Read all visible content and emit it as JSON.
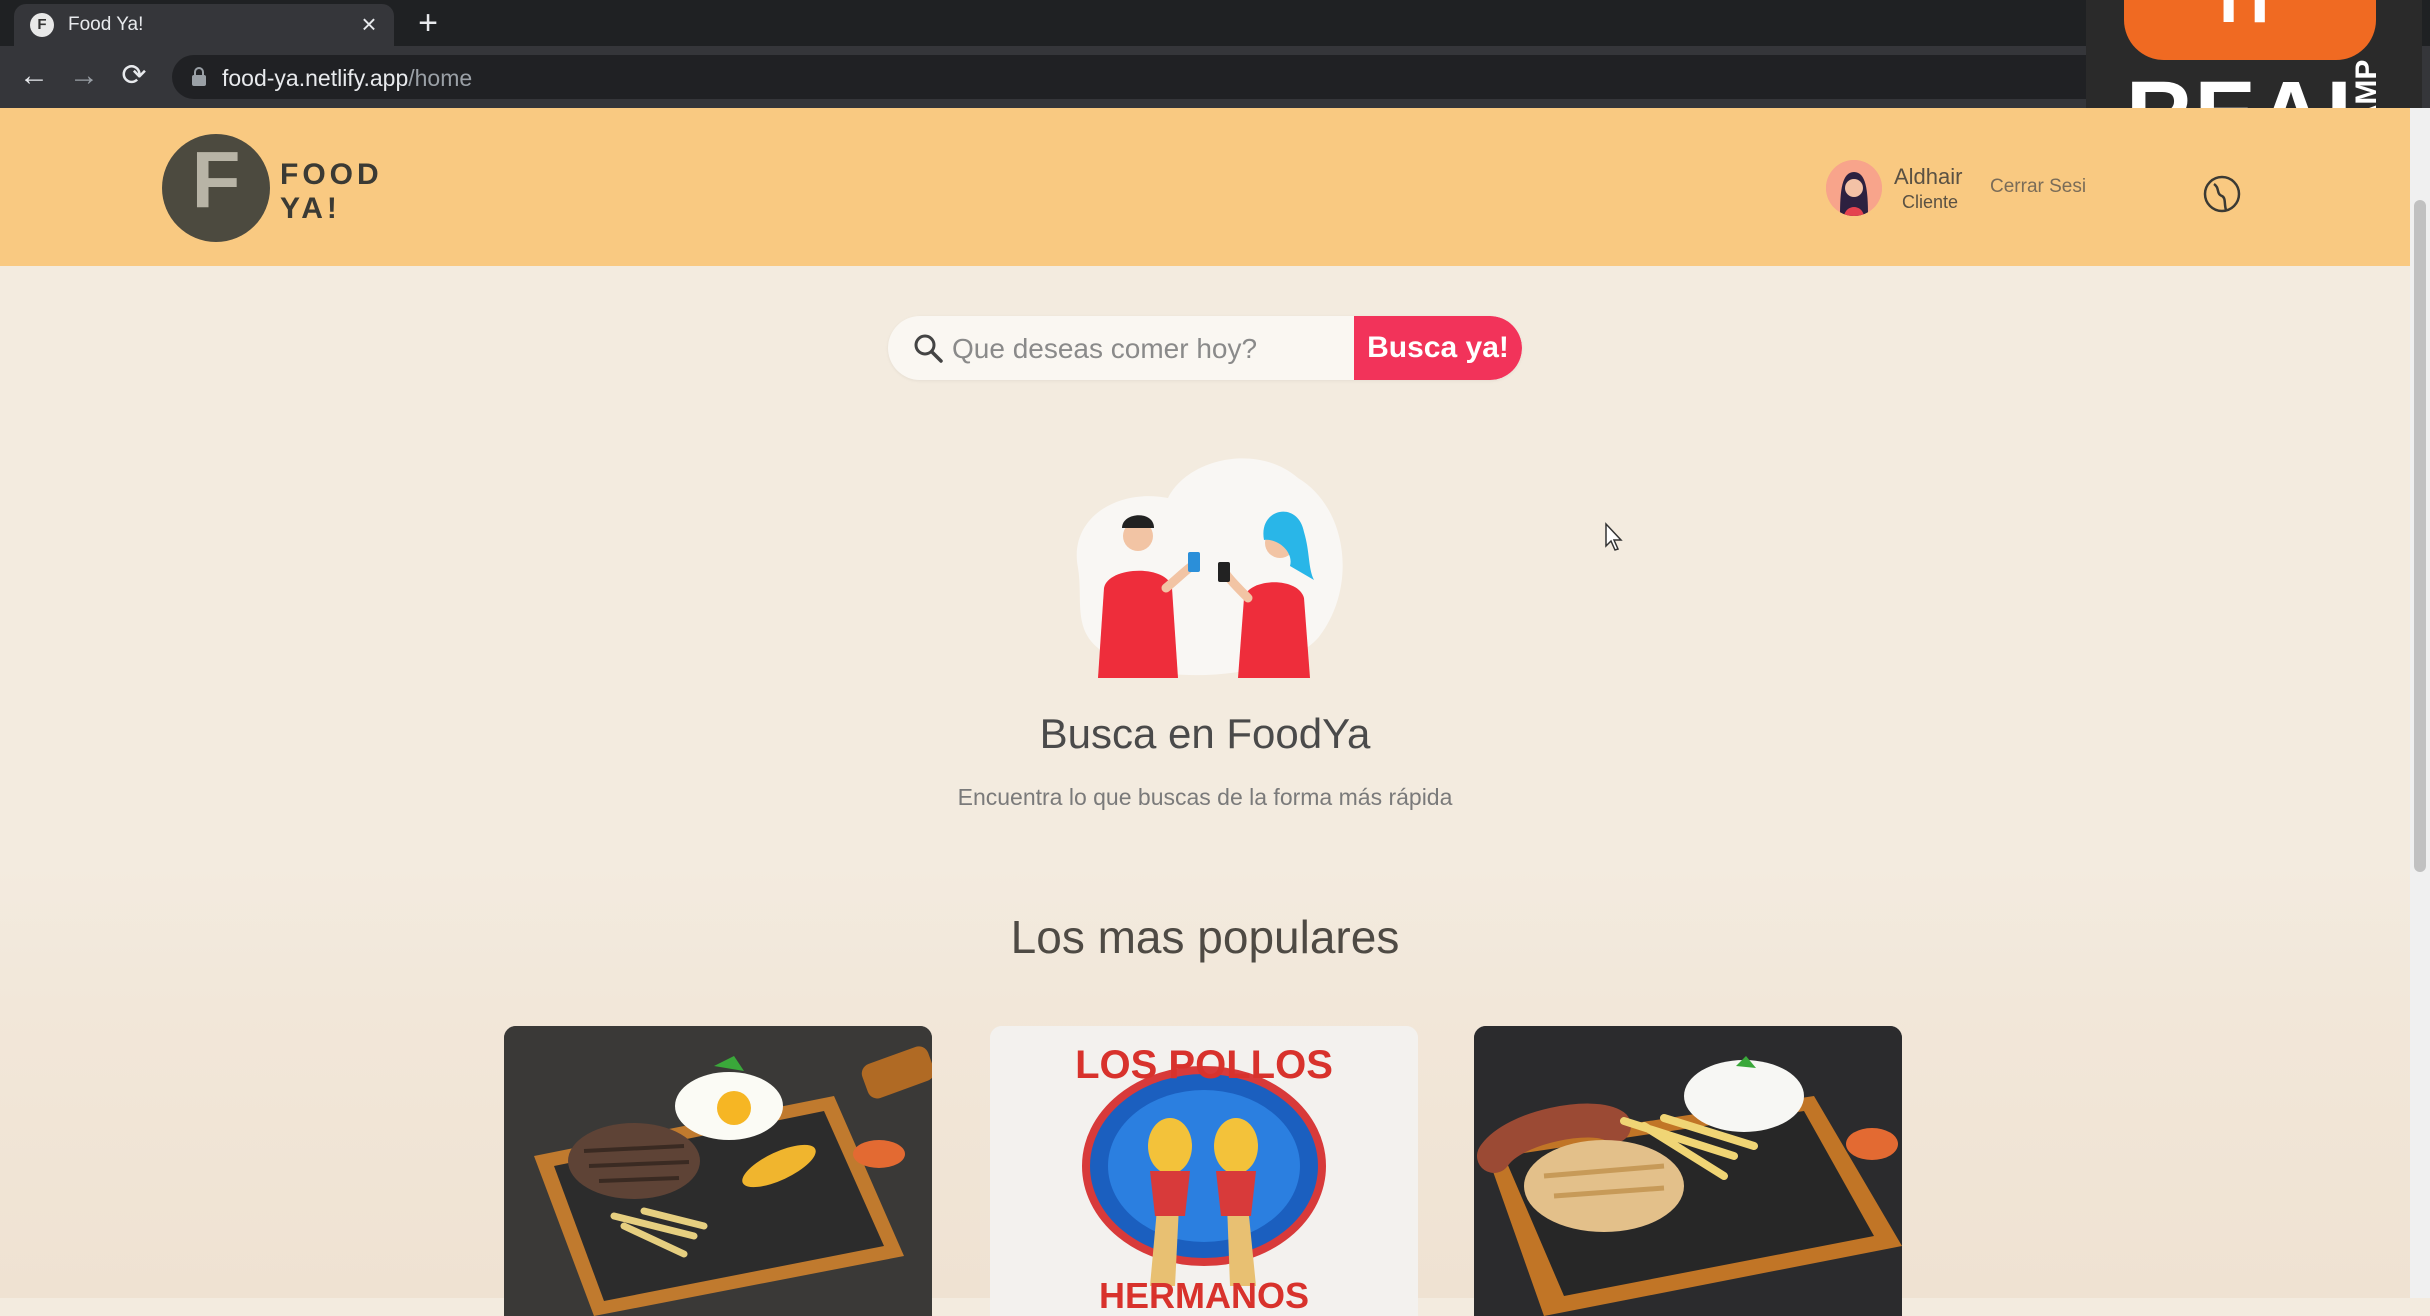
{
  "browser": {
    "tab_title": "Food Ya!",
    "tab_favicon": "F",
    "tab_close": "×",
    "new_tab": "+",
    "back": "←",
    "forward": "→",
    "reload": "⟳",
    "url_host": "food-ya.netlify.app",
    "url_path": "/home"
  },
  "watermark": {
    "top": "IT",
    "main": "REAL",
    "side": "CAMP"
  },
  "header": {
    "logo_letter": "F",
    "logo_line1": "FOOD",
    "logo_line2": "YA!",
    "user_name": "Aldhair",
    "user_role": "Cliente",
    "logout_label": "Cerrar Sesi"
  },
  "search": {
    "placeholder": "Que deseas comer hoy?",
    "button_label": "Busca ya!"
  },
  "hero": {
    "title": "Busca en FoodYa",
    "subtitle": "Encuentra lo que buscas de la forma más rápida"
  },
  "popular": {
    "title": "Los mas populares",
    "cards": [
      {
        "name": "card-steak-egg"
      },
      {
        "name": "card-los-pollos-hermanos",
        "logo_top": "LOS POLLOS",
        "logo_bottom": "HERMANOS"
      },
      {
        "name": "card-chicken-sausage"
      }
    ]
  },
  "colors": {
    "header_bg": "#f9c981",
    "page_bg": "#f3ebdf",
    "accent": "#f2335a"
  }
}
